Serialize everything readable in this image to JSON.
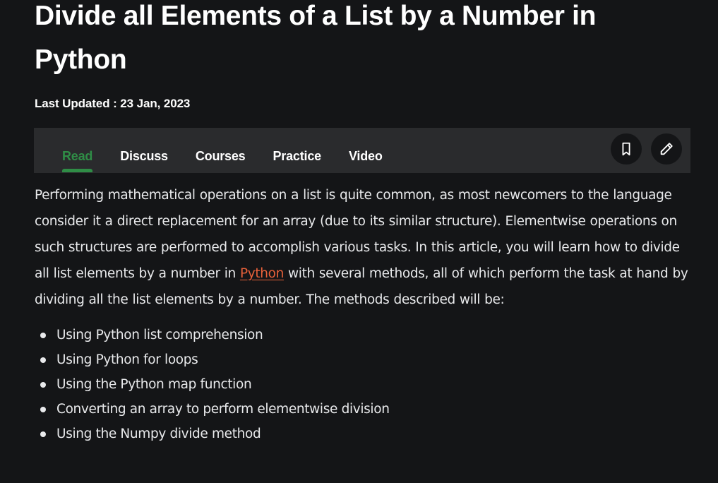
{
  "article": {
    "title": "Divide all Elements of a List by a Number in Python",
    "last_updated": "Last Updated : 23 Jan, 2023"
  },
  "tabs": [
    {
      "label": "Read",
      "active": true
    },
    {
      "label": "Discuss",
      "active": false
    },
    {
      "label": "Courses",
      "active": false
    },
    {
      "label": "Practice",
      "active": false
    },
    {
      "label": "Video",
      "active": false
    }
  ],
  "actions": {
    "bookmark_icon": "bookmark-icon",
    "edit_icon": "pencil-icon"
  },
  "body": {
    "para_before_link": "Performing mathematical operations on a list is quite common, as most newcomers to the language consider it a direct replacement for an array (due to its similar structure). Elementwise operations on such structures are performed to accomplish various tasks. In this article, you will learn how to divide all list elements by a number in ",
    "link_text": "Python",
    "para_after_link": " with several methods, all of which perform the task at hand by dividing all the list elements by a number. The methods described will be:",
    "methods": [
      "Using Python list comprehension",
      "Using Python for loops",
      "Using the Python map function",
      "Converting an array to perform elementwise division",
      "Using the Numpy divide method"
    ]
  },
  "colors": {
    "background": "#141517",
    "tabbar": "#2a2b2d",
    "accent_green": "#2f8d46",
    "link_orange": "#e8613a",
    "text": "#e9eaec"
  }
}
